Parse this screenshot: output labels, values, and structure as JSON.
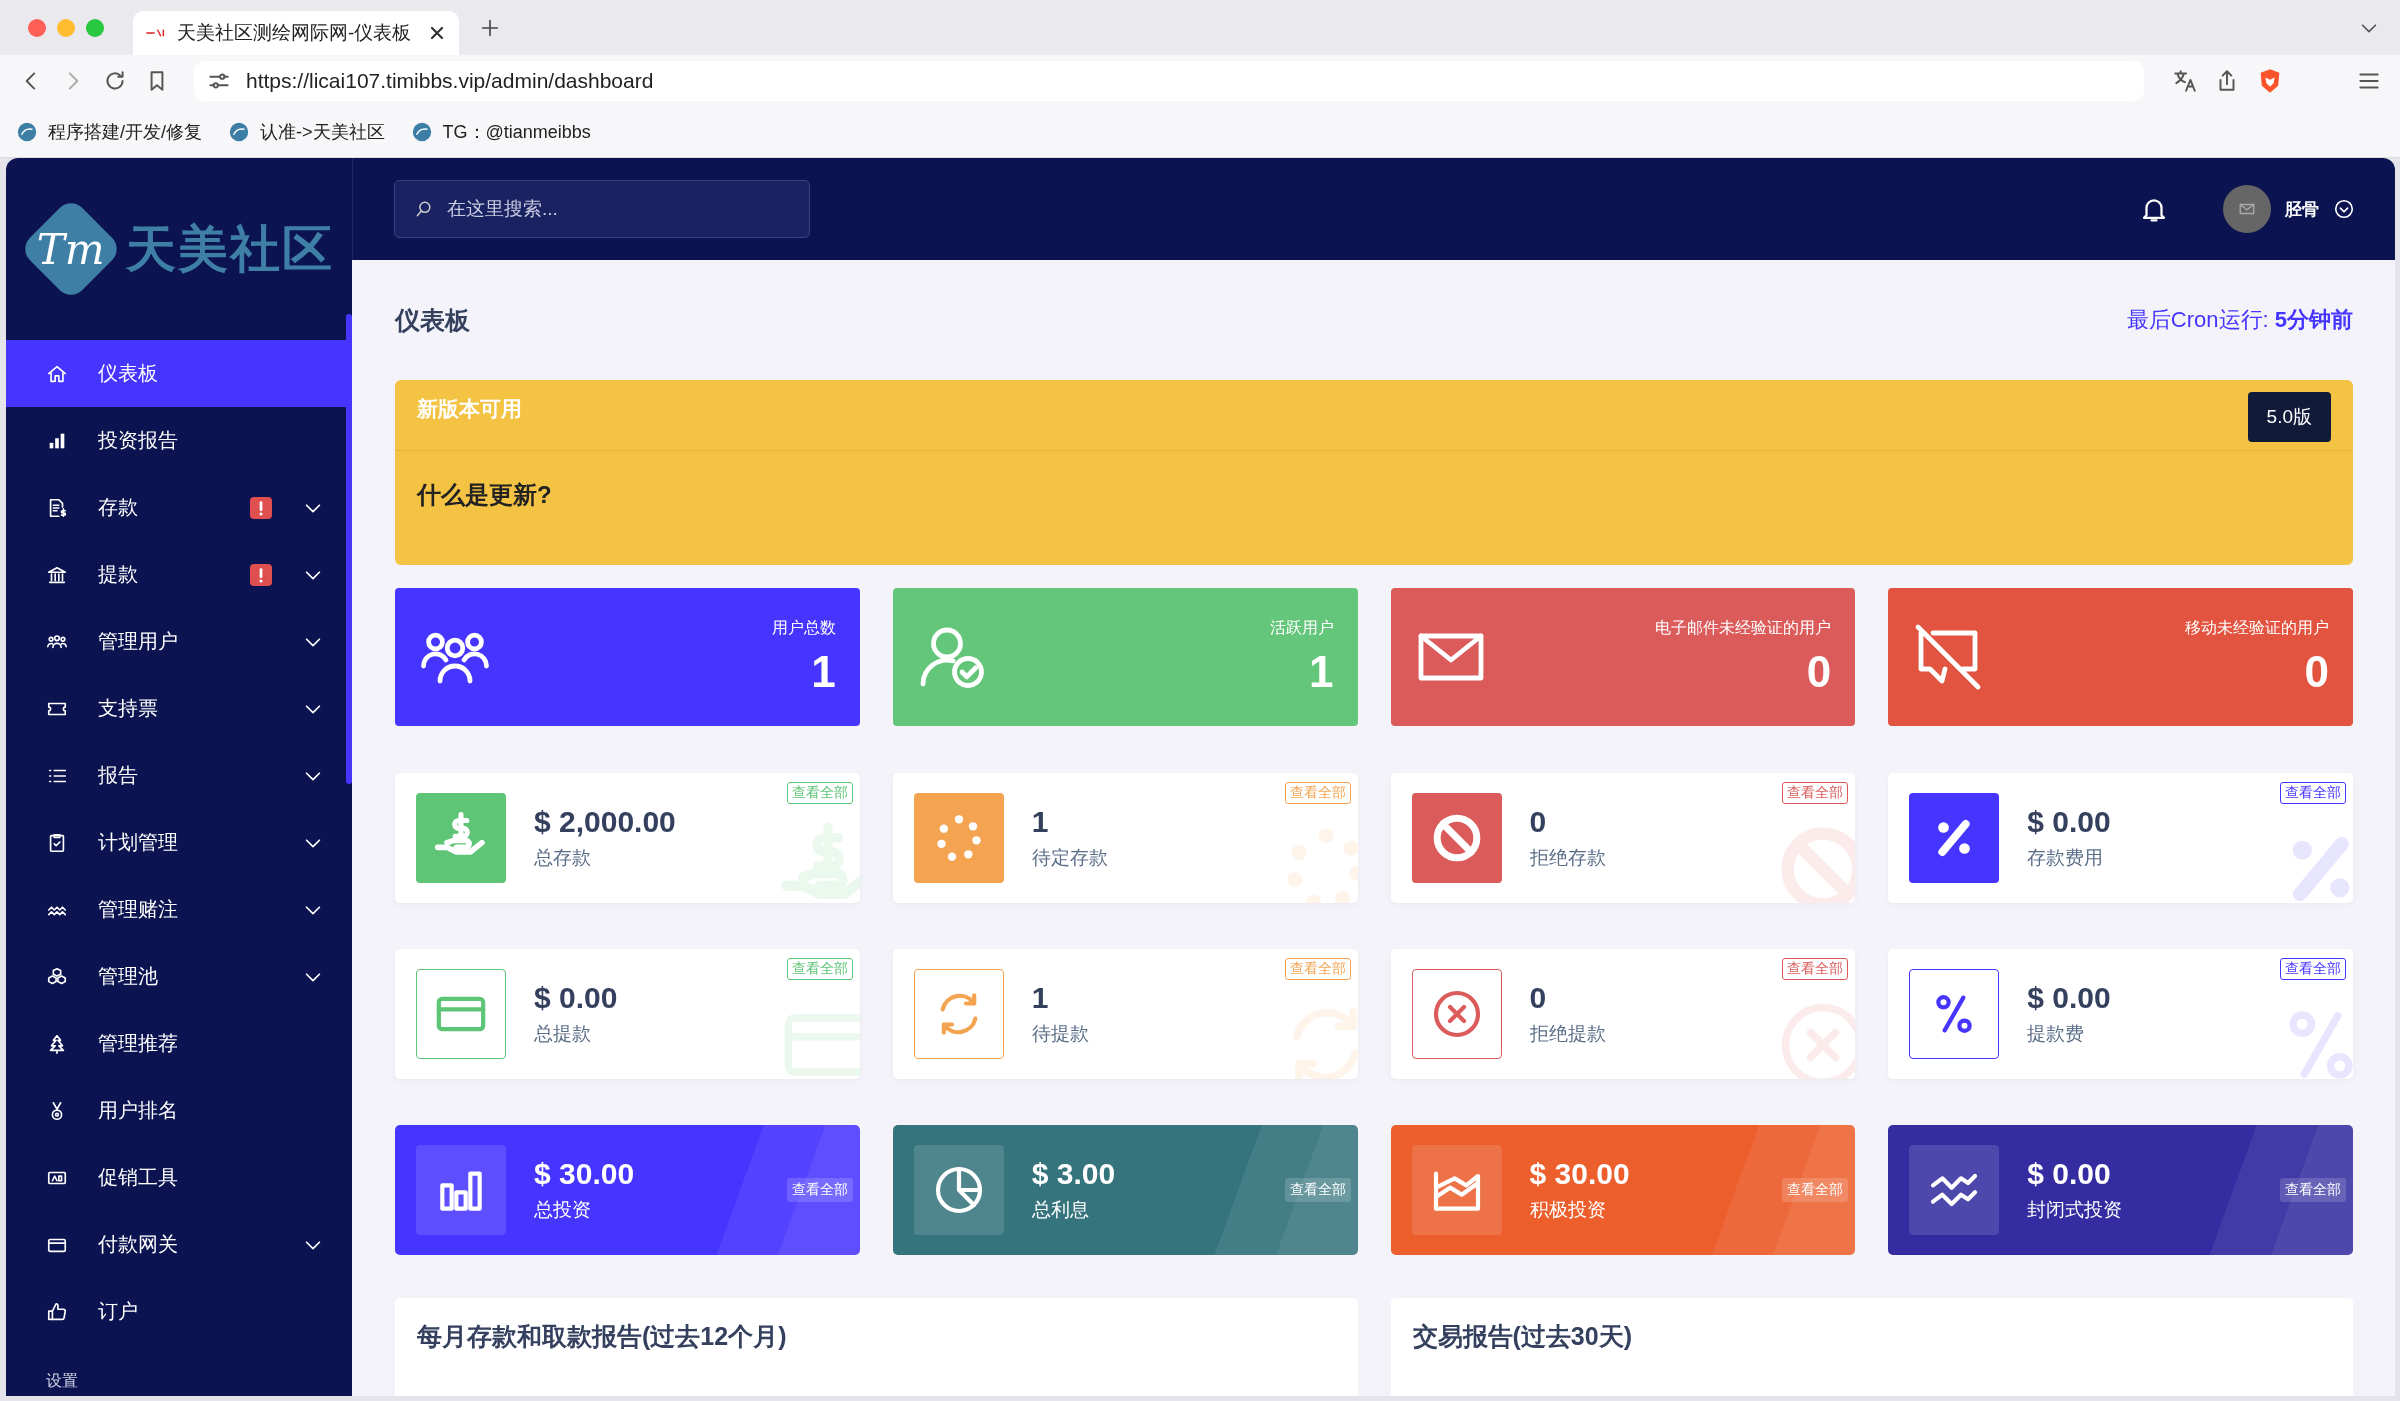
{
  "browser": {
    "tab_title": "天美社区测绘网际网-仪表板",
    "url": "https://licai107.timibbs.vip/admin/dashboard",
    "bookmarks": [
      "程序搭建/开发/修复",
      "认准->天美社区",
      "TG：@tianmeibbs"
    ]
  },
  "sidebar": {
    "logo_mark": "Tm",
    "logo_text": "天美社区",
    "items": [
      {
        "label": "仪表板",
        "selected": true,
        "alert": false,
        "expandable": false
      },
      {
        "label": "投资报告",
        "selected": false,
        "alert": false,
        "expandable": false
      },
      {
        "label": "存款",
        "selected": false,
        "alert": true,
        "expandable": true
      },
      {
        "label": "提款",
        "selected": false,
        "alert": true,
        "expandable": true
      },
      {
        "label": "管理用户",
        "selected": false,
        "alert": false,
        "expandable": true
      },
      {
        "label": "支持票",
        "selected": false,
        "alert": false,
        "expandable": true
      },
      {
        "label": "报告",
        "selected": false,
        "alert": false,
        "expandable": true
      },
      {
        "label": "计划管理",
        "selected": false,
        "alert": false,
        "expandable": true
      },
      {
        "label": "管理赌注",
        "selected": false,
        "alert": false,
        "expandable": true
      },
      {
        "label": "管理池",
        "selected": false,
        "alert": false,
        "expandable": true
      },
      {
        "label": "管理推荐",
        "selected": false,
        "alert": false,
        "expandable": false
      },
      {
        "label": "用户排名",
        "selected": false,
        "alert": false,
        "expandable": false
      },
      {
        "label": "促销工具",
        "selected": false,
        "alert": false,
        "expandable": false
      },
      {
        "label": "付款网关",
        "selected": false,
        "alert": false,
        "expandable": true
      },
      {
        "label": "订户",
        "selected": false,
        "alert": false,
        "expandable": false
      }
    ],
    "section_label": "设置"
  },
  "header": {
    "search_placeholder": "在这里搜索...",
    "user_name": "胫骨"
  },
  "page": {
    "title": "仪表板",
    "cron": "最后Cron运行: **5分钟前**"
  },
  "update_banner": {
    "title": "新版本可用",
    "version": "5.0版",
    "heading": "什么是更新?"
  },
  "user_stats": [
    {
      "label": "用户总数",
      "value": "1",
      "color": "#4634ff"
    },
    {
      "label": "活跃用户",
      "value": "1",
      "color": "#64c67a"
    },
    {
      "label": "电子邮件未经验证的用户",
      "value": "0",
      "color": "#db5b5b"
    },
    {
      "label": "移动未经验证的用户",
      "value": "0",
      "color": "#e25440"
    }
  ],
  "deposit_cards": [
    {
      "value": "$ 2,000.00",
      "label": "总存款",
      "link": "查看全部",
      "color": "#5ec476"
    },
    {
      "value": "1",
      "label": "待定存款",
      "link": "查看全部",
      "color": "#f4a451"
    },
    {
      "value": "0",
      "label": "拒绝存款",
      "link": "查看全部",
      "color": "#db5b5b"
    },
    {
      "value": "$ 0.00",
      "label": "存款费用",
      "link": "查看全部",
      "color": "#4634ff"
    }
  ],
  "withdrawal_cards": [
    {
      "value": "$ 0.00",
      "label": "总提款",
      "link": "查看全部",
      "color": "#5ec476"
    },
    {
      "value": "1",
      "label": "待提款",
      "link": "查看全部",
      "color": "#f4a451"
    },
    {
      "value": "0",
      "label": "拒绝提款",
      "link": "查看全部",
      "color": "#db5b5b"
    },
    {
      "value": "$ 0.00",
      "label": "提款费",
      "link": "查看全部",
      "color": "#4634ff"
    }
  ],
  "investment_cards": [
    {
      "value": "$ 30.00",
      "label": "总投资",
      "link": "查看全部",
      "color": "#4634ff"
    },
    {
      "value": "$ 3.00",
      "label": "总利息",
      "link": "查看全部",
      "color": "#35747d"
    },
    {
      "value": "$ 30.00",
      "label": "积极投资",
      "link": "查看全部",
      "color": "#ec5e2c"
    },
    {
      "value": "$ 0.00",
      "label": "封闭式投资",
      "link": "查看全部",
      "color": "#342ca0"
    }
  ],
  "reports": [
    {
      "title": "每月存款和取款报告(过去12个月)"
    },
    {
      "title": "交易报告(过去30天)"
    }
  ]
}
